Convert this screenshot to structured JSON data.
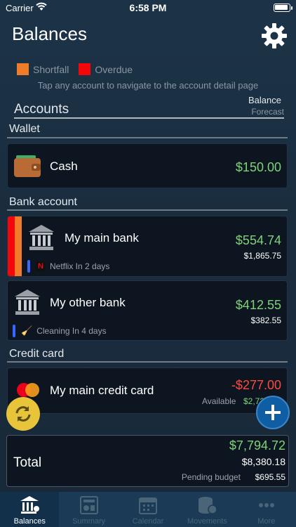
{
  "status": {
    "carrier": "Carrier",
    "time": "6:58 PM"
  },
  "header": {
    "title": "Balances"
  },
  "legend": {
    "shortfall_label": "Shortfall",
    "shortfall_color": "#f07c2a",
    "overdue_label": "Overdue",
    "overdue_color": "#f4060b",
    "hint": "Tap any account to navigate to the account detail page"
  },
  "accounts_header": {
    "title": "Accounts",
    "balance_label": "Balance",
    "forecast_label": "Forecast"
  },
  "sections": {
    "wallet": "Wallet",
    "bank": "Bank account",
    "credit": "Credit card"
  },
  "accounts": {
    "cash": {
      "name": "Cash",
      "balance": "$150.00"
    },
    "main_bank": {
      "name": "My main bank",
      "balance": "$554.74",
      "forecast": "$1,865.75",
      "note": "Netflix In 2 days"
    },
    "other_bank": {
      "name": "My other bank",
      "balance": "$412.55",
      "forecast": "$382.55",
      "note": "Cleaning In 4 days"
    },
    "credit_card": {
      "name": "My main credit card",
      "balance": "-$277.00",
      "available_label": "Available",
      "available": "$2,723.00"
    }
  },
  "total": {
    "label": "Total",
    "balance": "$7,794.72",
    "forecast": "$8,380.18",
    "pending_label": "Pending budget",
    "pending": "$695.55"
  },
  "tabs": [
    {
      "label": "Balances",
      "icon": "bank-icon"
    },
    {
      "label": "Summary",
      "icon": "chart-icon"
    },
    {
      "label": "Calendar",
      "icon": "calendar-icon"
    },
    {
      "label": "Movements",
      "icon": "coins-icon"
    },
    {
      "label": "More",
      "icon": "more-icon"
    }
  ]
}
